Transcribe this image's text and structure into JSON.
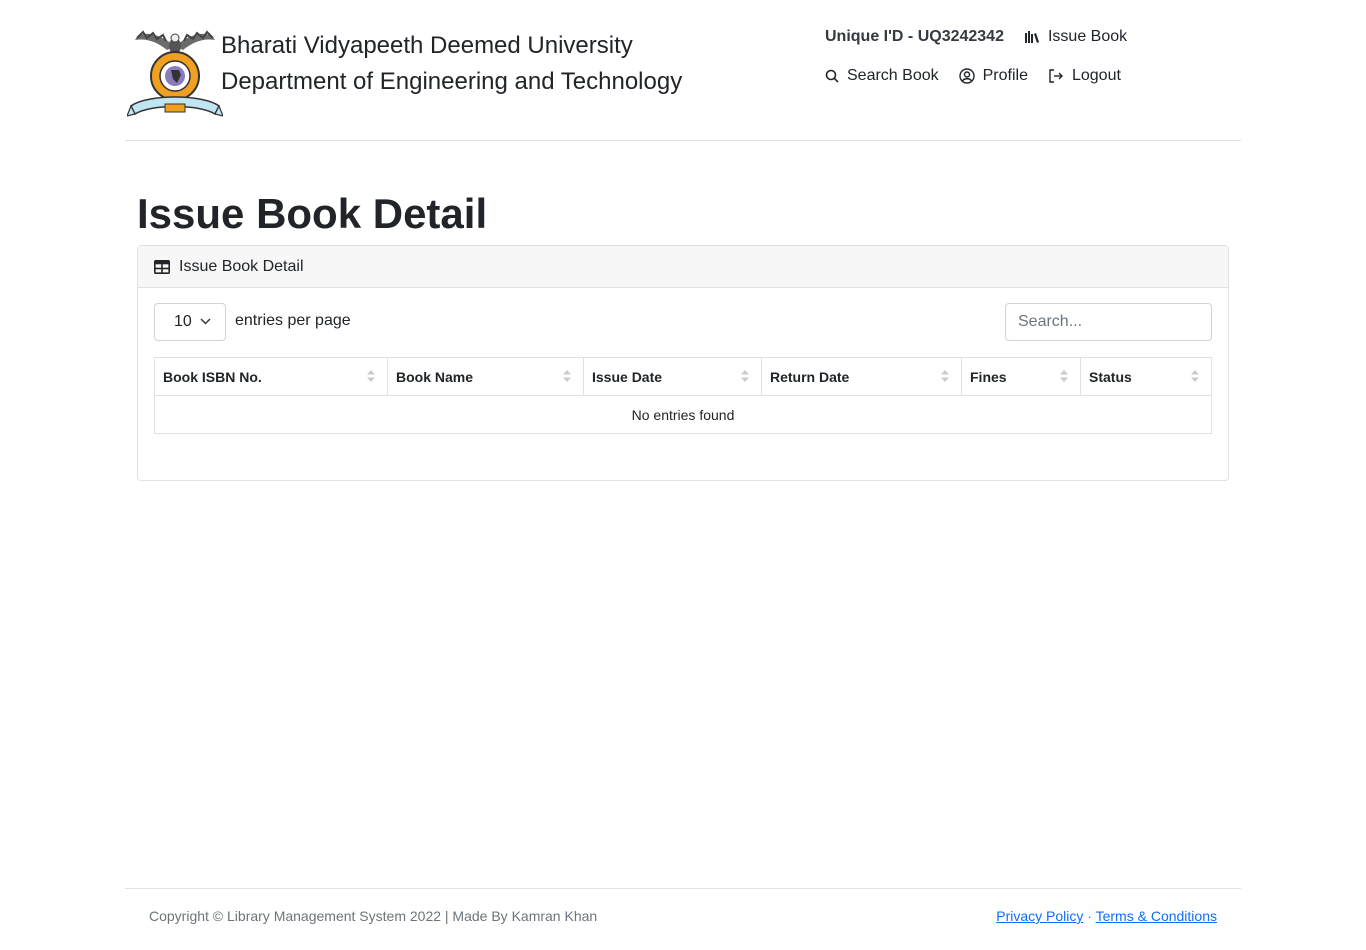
{
  "header": {
    "university": "Bharati Vidyapeeth Deemed University",
    "department": "Department of Engineering and Technology",
    "logo_icon": "university-crest-eagle"
  },
  "nav": {
    "unique_id": "Unique I'D - UQ3242342",
    "issue_book": "Issue Book",
    "search_book": "Search Book",
    "profile": "Profile",
    "logout": "Logout"
  },
  "page": {
    "title": "Issue Book Detail"
  },
  "card": {
    "header": "Issue Book Detail",
    "per_page_value": "10",
    "per_page_label": "entries per page",
    "search_placeholder": "Search...",
    "columns": [
      "Book ISBN No.",
      "Book Name",
      "Issue Date",
      "Return Date",
      "Fines",
      "Status"
    ],
    "empty_message": "No entries found"
  },
  "footer": {
    "copyright": "Copyright © Library Management System 2022 | Made By Kamran Khan",
    "privacy": "Privacy Policy",
    "separator": "·",
    "terms": "Terms & Conditions"
  },
  "colors": {
    "link": "#0d6efd",
    "muted": "#6c757d",
    "border": "#dee2e6",
    "card_header_bg": "#f7f7f7"
  }
}
